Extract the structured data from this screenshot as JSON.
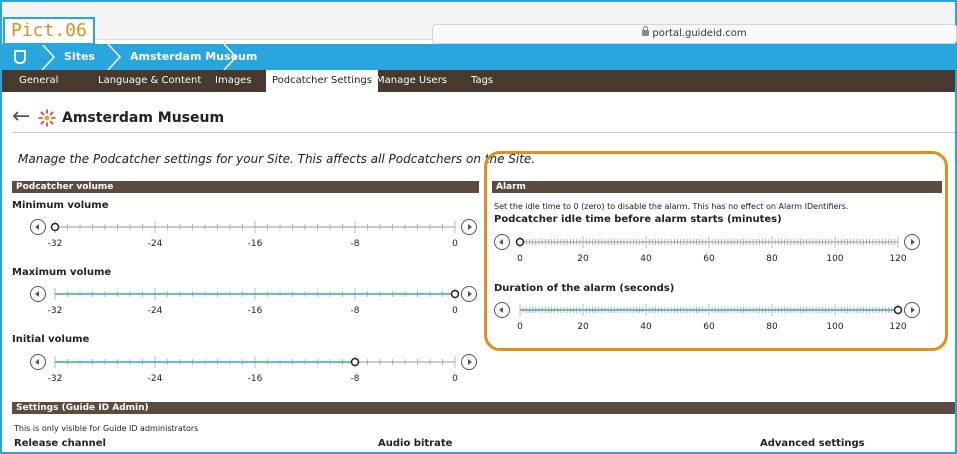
{
  "browser": {
    "pict_label": "Pict.06",
    "url": "portal.guideid.com"
  },
  "breadcrumb": {
    "items": [
      "Sites",
      "Amsterdam Museum"
    ]
  },
  "nav": {
    "items": [
      "General",
      "Language & Content",
      "Images",
      "Podcatcher Settings",
      "Manage Users",
      "Tags"
    ],
    "active": "Podcatcher Settings"
  },
  "page": {
    "title": "Amsterdam Museum",
    "intro": "Manage the Podcatcher settings for your Site. This affects all Podcatchers on the Site."
  },
  "volume": {
    "header": "Podcatcher volume",
    "sliders": [
      {
        "label": "Minimum volume",
        "value": -32,
        "ticks": [
          "-32",
          "-24",
          "-16",
          "-8",
          "0"
        ]
      },
      {
        "label": "Maximum volume",
        "value": 0,
        "ticks": [
          "-32",
          "-24",
          "-16",
          "-8",
          "0"
        ]
      },
      {
        "label": "Initial volume",
        "value": -8,
        "ticks": [
          "-32",
          "-24",
          "-16",
          "-8",
          "0"
        ]
      }
    ]
  },
  "alarm": {
    "header": "Alarm",
    "note": "Set the idle time to 0 (zero) to disable the alarm. This has no effect on Alarm IDentifiers.",
    "sliders": [
      {
        "label": "Podcatcher idle time before alarm starts (minutes)",
        "value": 0,
        "ticks": [
          "0",
          "20",
          "40",
          "60",
          "80",
          "100",
          "120"
        ]
      },
      {
        "label": "Duration of the alarm (seconds)",
        "value": 120,
        "ticks": [
          "0",
          "20",
          "40",
          "60",
          "80",
          "100",
          "120"
        ]
      }
    ]
  },
  "admin": {
    "header": "Settings (Guide ID Admin)",
    "note": "This is only visible for Guide ID administrators",
    "columns": [
      "Release channel",
      "Audio bitrate",
      "Advanced settings"
    ]
  },
  "colors": {
    "brand_blue": "#2aa6de",
    "nav_brown": "#47392d",
    "section_brown": "#5b4b40",
    "highlight_orange": "#e0901a"
  }
}
